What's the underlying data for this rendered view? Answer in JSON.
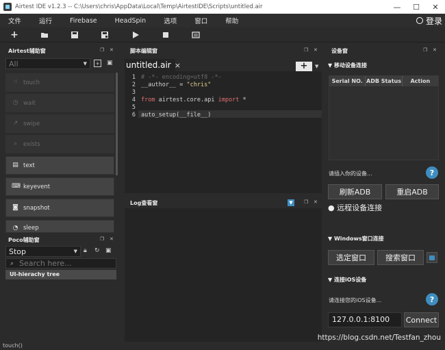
{
  "window": {
    "title": "Airtest IDE v1.2.3 -- C:\\Users\\chris\\AppData\\Local\\Temp\\AirtestIDE\\Scripts\\untitled.air",
    "controls": {
      "minimize": "—",
      "maximize": "☐",
      "close": "✕"
    }
  },
  "menu": {
    "items": [
      "文件",
      "运行",
      "Firebase",
      "HeadSpin",
      "选项",
      "窗口",
      "帮助"
    ],
    "login": "登录"
  },
  "toolbar": {
    "icons": [
      "plus-icon",
      "folder-open-icon",
      "save-icon",
      "save-as-icon",
      "play-icon",
      "stop-icon",
      "report-icon"
    ]
  },
  "airtest_panel": {
    "title": "Airtest辅助窗",
    "filter": "All",
    "buttons": [
      {
        "label": "touch",
        "icon": "touch-icon",
        "enabled": false
      },
      {
        "label": "wait",
        "icon": "clock-icon",
        "enabled": false
      },
      {
        "label": "swipe",
        "icon": "swipe-icon",
        "enabled": false
      },
      {
        "label": "exists",
        "icon": "magnifier-icon",
        "enabled": false
      },
      {
        "label": "text",
        "icon": "text-icon",
        "enabled": true
      },
      {
        "label": "keyevent",
        "icon": "keyboard-icon",
        "enabled": true
      },
      {
        "label": "snapshot",
        "icon": "camera-icon",
        "enabled": true
      },
      {
        "label": "sleep",
        "icon": "sleep-icon",
        "enabled": true
      }
    ]
  },
  "editor": {
    "title": "脚本编辑窗",
    "tab": "untitled.air",
    "tab_close": "×",
    "add": "+",
    "lines": [
      {
        "n": "1",
        "text": "# -*- encoding=utf8 -*-"
      },
      {
        "n": "2",
        "text": "__author__ = \"chris\""
      },
      {
        "n": "3",
        "text": ""
      },
      {
        "n": "4",
        "text": "from airtest.core.api import *"
      },
      {
        "n": "5",
        "text": ""
      },
      {
        "n": "6",
        "text": "auto_setup(__file__)"
      }
    ]
  },
  "log_panel": {
    "title": "Log查看窗"
  },
  "poco_panel": {
    "title": "Poco辅助窗",
    "mode": "Stop",
    "search_placeholder": "Search here...",
    "tree_item": "UI-hierachy tree"
  },
  "devices": {
    "title": "设备窗",
    "mobile_section": "移动设备连接",
    "columns": [
      "Serial NO.",
      "ADB Status",
      "Action"
    ],
    "prompt": "请插入你的设备...",
    "refresh_adb": "刷新ADB",
    "restart_adb": "重启ADB",
    "remote": "远程设备连接",
    "windows_section": "Windows窗口连接",
    "select_window": "选定窗口",
    "search_window": "搜索窗口",
    "ios_section": "连接iOS设备",
    "ios_prompt": "请连接您的iOS设备...",
    "ios_address": "127.0.0.1:8100",
    "connect": "Connect"
  },
  "status": {
    "text": "touch()"
  },
  "watermark": "https://blog.csdn.net/Testfan_zhou"
}
